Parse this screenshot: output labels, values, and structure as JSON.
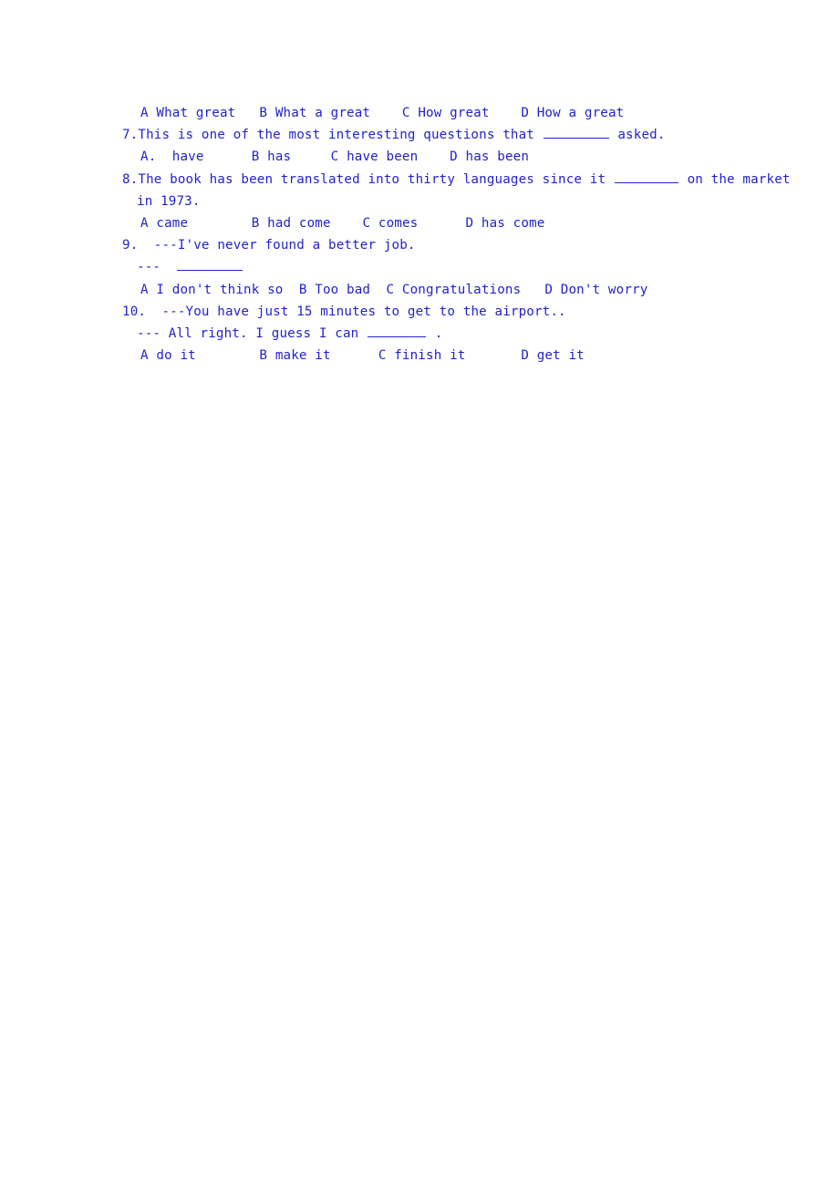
{
  "document": {
    "text_color": "#2222cc",
    "background_color": "#ffffff",
    "questions": [
      {
        "id": "q6-options",
        "kind": "options_only",
        "options": [
          {
            "letter": "A",
            "text": "What great"
          },
          {
            "letter": "B",
            "text": "What a great"
          },
          {
            "letter": "C",
            "text": "How great"
          },
          {
            "letter": "D",
            "text": "How a great"
          }
        ]
      },
      {
        "id": "q7",
        "number": "7.",
        "stem_before": "This is one of the most interesting questions that ",
        "stem_after": " asked.",
        "options": [
          {
            "letter": "A.",
            "text": " have"
          },
          {
            "letter": "B",
            "text": "has"
          },
          {
            "letter": "C",
            "text": "have been"
          },
          {
            "letter": "D",
            "text": "has been"
          }
        ]
      },
      {
        "id": "q8",
        "number": "8.",
        "stem_before": "The book has been translated into thirty languages since it ",
        "stem_after": " on the market",
        "continuation": "in 1973.",
        "options": [
          {
            "letter": "A",
            "text": "came"
          },
          {
            "letter": "B",
            "text": "had come"
          },
          {
            "letter": "C",
            "text": "comes"
          },
          {
            "letter": "D",
            "text": "has come"
          }
        ]
      },
      {
        "id": "q9",
        "number": "9.",
        "speaker_line": "---I've never found a better job.",
        "reply_dash": "---",
        "options": [
          {
            "letter": "A",
            "text": "I don't think so"
          },
          {
            "letter": "B",
            "text": "Too bad"
          },
          {
            "letter": "C",
            "text": "Congratulations"
          },
          {
            "letter": "D",
            "text": "Don't worry"
          }
        ]
      },
      {
        "id": "q10",
        "number": "10.",
        "speaker_line": "---You have just 15 minutes to get to the airport..",
        "reply_before": "--- All right. I guess I can ",
        "reply_after": " .",
        "options": [
          {
            "letter": "A",
            "text": "do it"
          },
          {
            "letter": "B",
            "text": "make it"
          },
          {
            "letter": "C",
            "text": "finish it"
          },
          {
            "letter": "D",
            "text": "get it"
          }
        ]
      }
    ]
  }
}
